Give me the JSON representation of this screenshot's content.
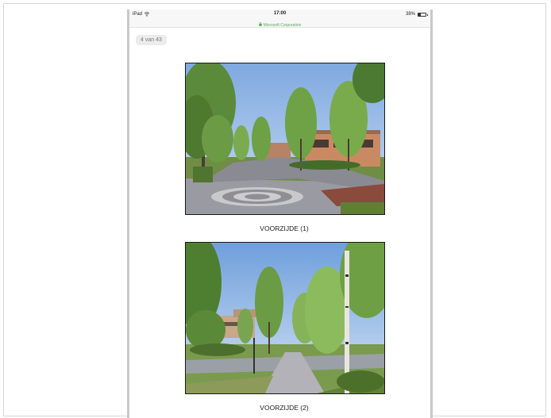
{
  "status_bar": {
    "device": "iPad",
    "time": "17:00",
    "host": "Microsoft Corporation",
    "battery": "38%",
    "battery_level": 0.38
  },
  "document": {
    "page_counter": "4 van 43",
    "photos": [
      {
        "caption": "VOORZIJDE (1)"
      },
      {
        "caption": "VOORZIJDE (2)"
      }
    ]
  }
}
